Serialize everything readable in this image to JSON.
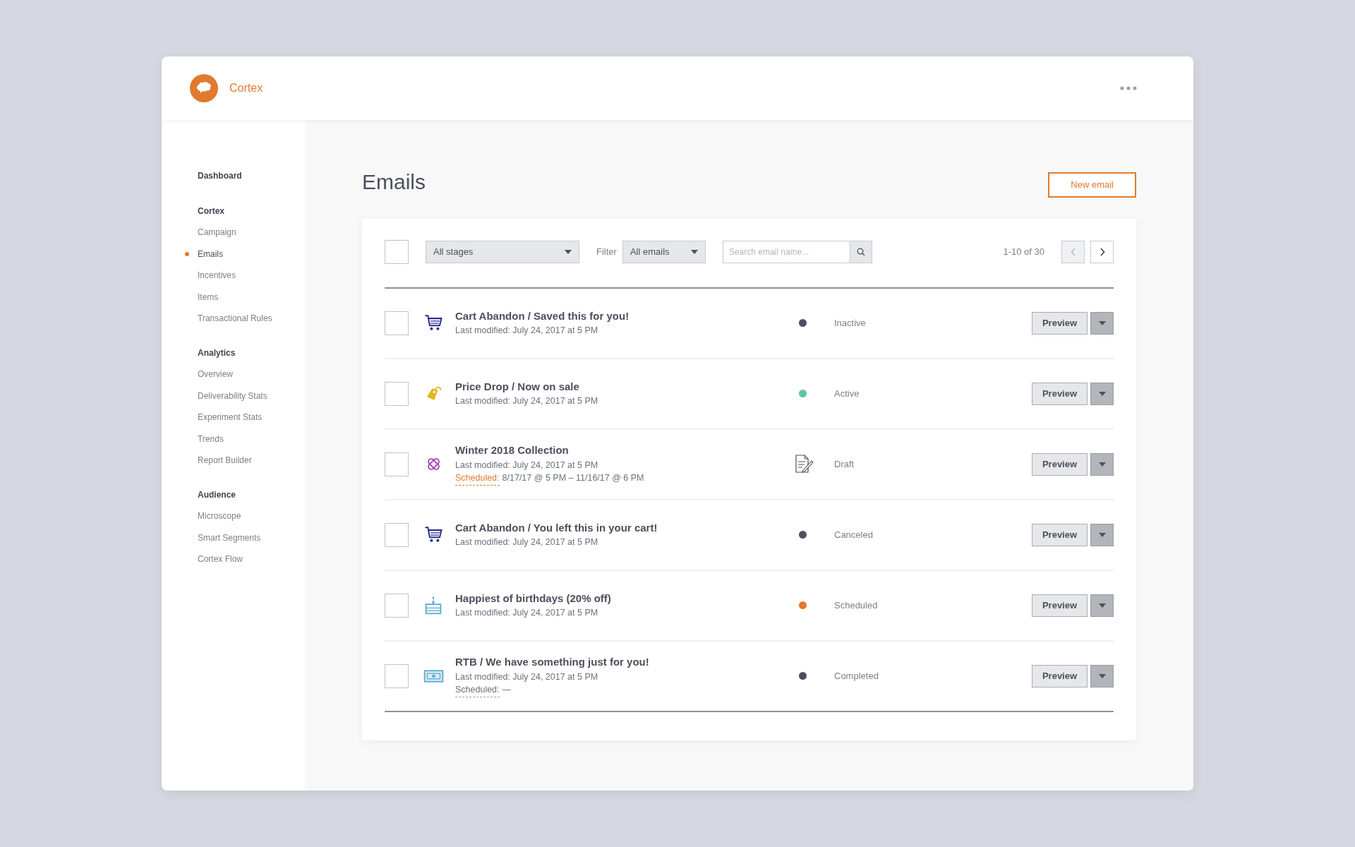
{
  "app": {
    "name": "Cortex"
  },
  "sidebar": {
    "sections": [
      {
        "heading": "Dashboard"
      },
      {
        "heading": "Cortex",
        "items": [
          {
            "label": "Campaign",
            "selected": false
          },
          {
            "label": "Emails",
            "selected": true
          },
          {
            "label": "Incentives",
            "selected": false
          },
          {
            "label": "Items",
            "selected": false
          },
          {
            "label": "Transactional Rules",
            "selected": false
          }
        ]
      },
      {
        "heading": "Analytics",
        "items": [
          {
            "label": "Overview",
            "selected": false
          },
          {
            "label": "Deliverability Stats",
            "selected": false
          },
          {
            "label": "Experiment Stats",
            "selected": false
          },
          {
            "label": "Trends",
            "selected": false
          },
          {
            "label": "Report Builder",
            "selected": false
          }
        ]
      },
      {
        "heading": "Audience",
        "items": [
          {
            "label": "Microscope",
            "selected": false
          },
          {
            "label": "Smart Segments",
            "selected": false
          },
          {
            "label": "Cortex Flow",
            "selected": false
          }
        ]
      }
    ]
  },
  "page": {
    "title": "Emails",
    "new_button": "New email"
  },
  "toolbar": {
    "select_all": {
      "checked": false
    },
    "stage_select": "All stages",
    "filter_label": "Filter",
    "filter_select": "All emails",
    "search": {
      "placeholder": "Search email name..."
    },
    "range": "1-10 of 30",
    "prev": {
      "disabled": true
    },
    "next": {
      "disabled": false
    }
  },
  "rows": [
    {
      "checked": false,
      "kind": "cart",
      "title": "Cart Abandon / Saved this for you!",
      "modified": "Last modified: July 24, 2017 at 5 PM",
      "status": {
        "kind": "dot",
        "color": "#4b505c",
        "label": "Inactive"
      },
      "preview": "Preview"
    },
    {
      "checked": false,
      "kind": "tag",
      "title": "Price Drop / Now on sale",
      "modified": "Last modified: July 24, 2017 at 5 PM",
      "status": {
        "kind": "dot",
        "color": "#5fc4a3",
        "label": "Active"
      },
      "preview": "Preview"
    },
    {
      "checked": false,
      "kind": "bandage",
      "title": "Winter 2018 Collection",
      "modified": "Last modified: July 24, 2017 at 5 PM",
      "schedule": {
        "label": "Scheduled:",
        "value": "8/17/17 @ 5 PM – 11/16/17 @ 6 PM",
        "highlighted": true
      },
      "status": {
        "kind": "draft",
        "label": "Draft"
      },
      "preview": "Preview"
    },
    {
      "checked": false,
      "kind": "cart",
      "title": "Cart Abandon / You left this in your cart!",
      "modified": "Last modified: July 24, 2017 at 5 PM",
      "status": {
        "kind": "dot",
        "color": "#4b505c",
        "label": "Canceled"
      },
      "preview": "Preview"
    },
    {
      "checked": false,
      "kind": "cake",
      "title": "Happiest of birthdays (20% off)",
      "modified": "Last modified: July 24, 2017 at 5 PM",
      "status": {
        "kind": "dot",
        "color": "#e07a2e",
        "label": "Scheduled"
      },
      "preview": "Preview"
    },
    {
      "checked": false,
      "kind": "cash",
      "title": "RTB / We have something just for you!",
      "modified": "Last modified: July 24, 2017 at 5 PM",
      "schedule": {
        "label": "Scheduled:",
        "value": "—",
        "highlighted": false
      },
      "status": {
        "kind": "dot",
        "color": "#4b505c",
        "label": "Completed"
      },
      "preview": "Preview"
    }
  ]
}
